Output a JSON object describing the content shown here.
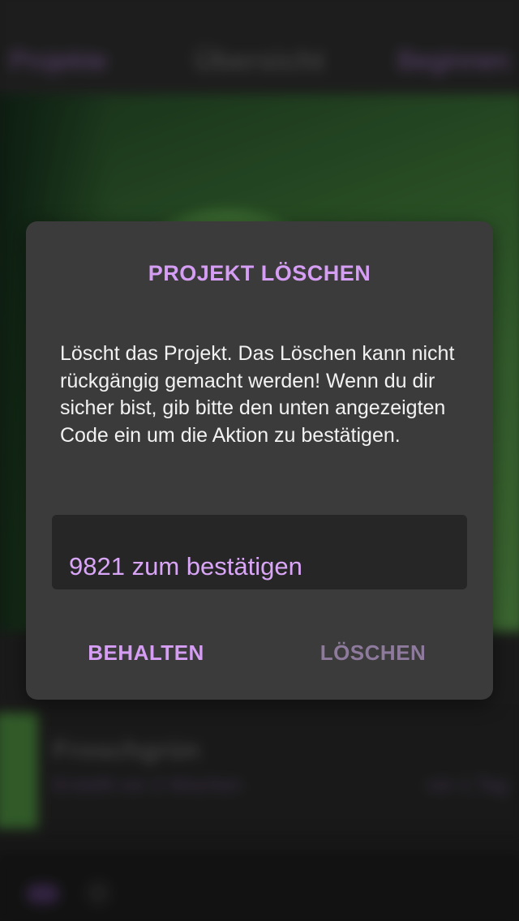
{
  "background": {
    "nav_left": "Projekte",
    "nav_title": "Übersicht",
    "nav_right": "Beginnen",
    "row_title": "Froschgrün",
    "row_subtitle": "Erstellt vor 2 Wochen",
    "row_meta": "vor 1 Tag"
  },
  "dialog": {
    "title": "PROJEKT LÖSCHEN",
    "message": "Löscht das Projekt. Das Löschen kann nicht rückgängig gemacht werden! Wenn du dir sicher bist, gib bitte den unten angezeigten Code ein um die Aktion zu bestätigen.",
    "input": {
      "value": "",
      "placeholder": "9821 zum bestätigen"
    },
    "buttons": {
      "keep_label": "BEHALTEN",
      "delete_label": "LÖSCHEN"
    }
  },
  "colors": {
    "accent": "#d59ef4",
    "accent_disabled": "#8e7a9c",
    "dialog_bg": "#3b3b3b",
    "field_bg": "#262626"
  }
}
